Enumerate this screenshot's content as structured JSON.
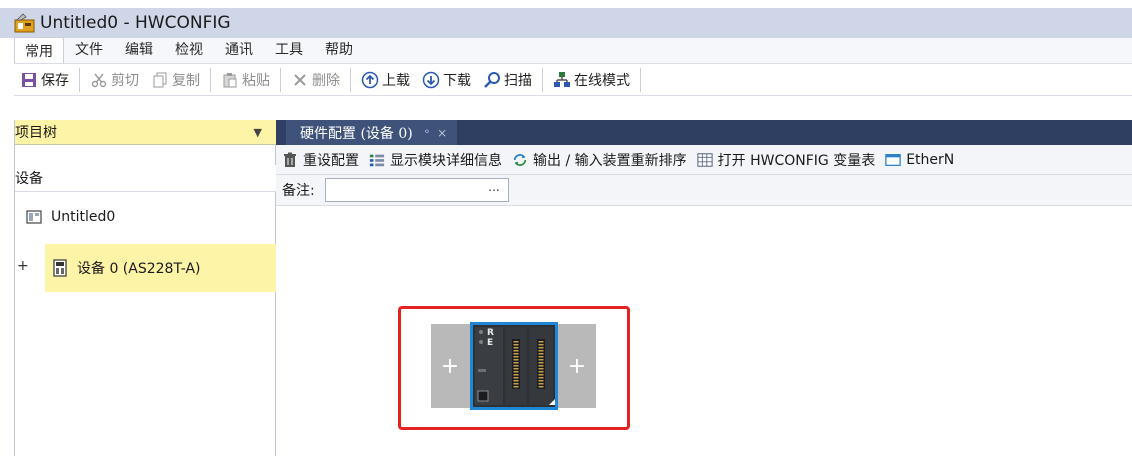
{
  "window": {
    "title": "Untitled0 - HWCONFIG"
  },
  "menu": {
    "items": [
      "常用",
      "文件",
      "编辑",
      "检视",
      "通讯",
      "工具",
      "帮助"
    ]
  },
  "ribbon": {
    "save": "保存",
    "cut": "剪切",
    "copy": "复制",
    "paste": "粘贴",
    "delete": "删除",
    "upload": "上载",
    "download": "下载",
    "scan": "扫描",
    "online": "在线模式"
  },
  "project_tree": {
    "header": "项目树",
    "section": "设备",
    "root": "Untitled0",
    "device": "设备 0 (AS228T-A)"
  },
  "document": {
    "tab_label": "硬件配置 (设备 0)",
    "toolbar": {
      "reset": "重设配置",
      "details": "显示模块详细信息",
      "reorder": "输出 / 输入装置重新排序",
      "open_vars": "打开 HWCONFIG 变量表",
      "ethernet": "EtherN"
    },
    "notes_label": "备注:",
    "notes_value": "",
    "notes_button": "...",
    "rack": {
      "add_left": "+",
      "add_right": "+",
      "led_r": "R",
      "led_e": "E"
    }
  },
  "colors": {
    "title_bar": "#cfd6e8",
    "tab_bar": "#2e3f62",
    "tree_highlight": "#fdf4a8",
    "selection_border": "#1e88d6",
    "annotation": "#e32222"
  }
}
